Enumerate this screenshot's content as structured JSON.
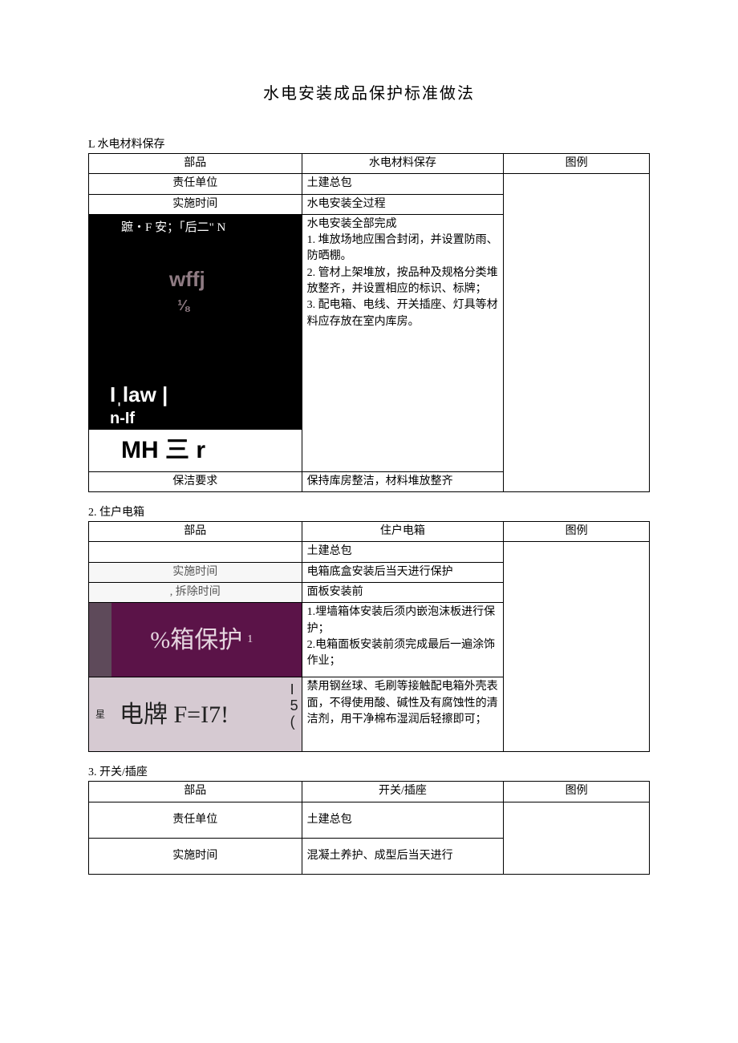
{
  "title": "水电安装成品保护标准做法",
  "section1": {
    "heading": "L 水电材料保存",
    "labels": {
      "部品": "部品",
      "水电材料保存": "水电材料保存",
      "图例": "图例",
      "责任单位": "责任单位",
      "实施时间": "实施时间",
      "保洁要求": "保洁要求"
    },
    "row_责任单位": "土建总包",
    "row_实施时间": "水电安装全过程",
    "desc": "水电安装全部完成\n1. 堆放场地应围合封闭，并设置防雨、防晒棚。\n2. 管材上架堆放，按品种及规格分类堆放整齐，并设置相应的标识、标牌；\n3. 配电箱、电线、开关插座、灯具等材料应存放在室内库房。",
    "img": {
      "l1": "蹠・F 安；「后二\" N",
      "l2": "wffj",
      "l3": "⅛",
      "l4": "Iˌlaw |",
      "l5": "n‑If",
      "bar": "MH 三 r"
    },
    "row_保洁要求": "保持库房整洁，材料堆放整齐"
  },
  "section2": {
    "heading": "2. 住户电箱",
    "labels": {
      "部品": "部品",
      "住户电箱": "住户电箱",
      "图例": "图例",
      "实施时间": "实施时间",
      "拆除时间": ", 拆除时间"
    },
    "row_责任单位": "土建总包",
    "row_实施时间": "电箱底盒安装后当天进行保护",
    "row_拆除时间": "面板安装前",
    "desc1": "1.埋墙箱体安装后须内嵌泡沫板进行保护；\n2.电箱面板安装前须完成最后一遍涂饰作业；",
    "desc2": "禁用钢丝球、毛刷等接触配电箱外壳表面，不得使用酸、碱性及有腐蚀性的清洁剂，用干净棉布湿润后轻擦即可；",
    "g1": {
      "text": "%箱保护",
      "sup": "1"
    },
    "g2": {
      "bar": "星",
      "text": "电牌 F=I7!",
      "side_top": "I",
      "side_mid": "5",
      "side_bot": "("
    }
  },
  "section3": {
    "heading": " 3. 开关/插座",
    "labels": {
      "部品": "部品",
      "开关插座": "开关/插座",
      "图例": "图例",
      "责任单位": "责任单位",
      "实施时间": "实施时间"
    },
    "row_责任单位": "土建总包",
    "row_实施时间": "混凝土养护、成型后当天进行"
  }
}
